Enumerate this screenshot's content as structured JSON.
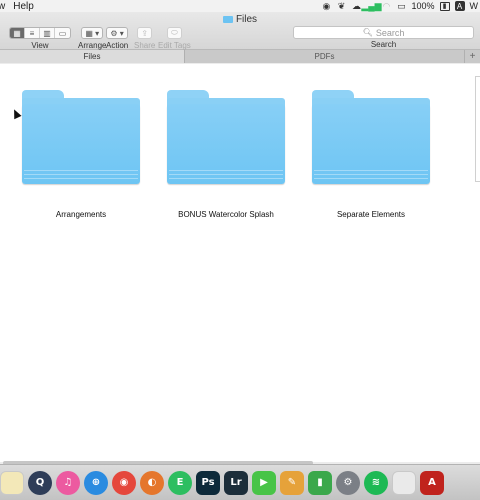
{
  "menubar": {
    "items": [
      "w",
      "Help"
    ],
    "battery": "100%",
    "input_source": "A",
    "clipped_right": "W",
    "status_icons": [
      "record-icon",
      "evernote-icon",
      "creative-cloud-icon",
      "signal-icon",
      "wifi-icon",
      "airplay-icon",
      "battery-icon",
      "input-source-icon"
    ]
  },
  "window": {
    "title": "Files",
    "accent_folder_color": "#6cc3f2"
  },
  "toolbar": {
    "view_label": "View",
    "arrange_label": "Arrange",
    "action_label": "Action",
    "share_label": "Share",
    "edit_tags_label": "Edit Tags",
    "search_label": "Search",
    "search_placeholder": "Search",
    "view_modes": [
      "icon-view-icon",
      "list-view-icon",
      "column-view-icon",
      "cover-flow-icon"
    ],
    "active_view": "icon-view-icon"
  },
  "tabs": [
    {
      "label": "Files",
      "active": true
    },
    {
      "label": "PDFs",
      "active": false
    }
  ],
  "new_tab_label": "+",
  "files": [
    {
      "name": "Arrangements",
      "icon": "folder-icon"
    },
    {
      "name": "BONUS Watercolor Splash",
      "icon": "folder-icon"
    },
    {
      "name": "Separate Elements",
      "icon": "folder-icon"
    }
  ],
  "dock": {
    "apps": [
      {
        "name": "notes-icon",
        "glyph": "",
        "color": "#f3e8b8"
      },
      {
        "name": "quicktime-icon",
        "glyph": "Q",
        "color": "#2e3d58"
      },
      {
        "name": "itunes-icon",
        "glyph": "♫",
        "color": "#ec5aa0"
      },
      {
        "name": "safari-icon",
        "glyph": "⊕",
        "color": "#2a8be0"
      },
      {
        "name": "chrome-icon",
        "glyph": "◉",
        "color": "#e5473c"
      },
      {
        "name": "firefox-icon",
        "glyph": "◐",
        "color": "#e5762c"
      },
      {
        "name": "evernote-icon",
        "glyph": "E",
        "color": "#2dbe60"
      },
      {
        "name": "photoshop-icon",
        "glyph": "Ps",
        "color": "#0d2a3a"
      },
      {
        "name": "lightroom-icon",
        "glyph": "Lr",
        "color": "#1c2e3a"
      },
      {
        "name": "facetime-icon",
        "glyph": "▶",
        "color": "#48c447"
      },
      {
        "name": "photo-editor-icon",
        "glyph": "✎",
        "color": "#e6a23a"
      },
      {
        "name": "numbers-icon",
        "glyph": "▮",
        "color": "#3ba84b"
      },
      {
        "name": "system-preferences-icon",
        "glyph": "⚙",
        "color": "#7b7f86"
      },
      {
        "name": "spotify-icon",
        "glyph": "≋",
        "color": "#1db954"
      },
      {
        "name": "document-icon",
        "glyph": "",
        "color": "#eaeaea"
      },
      {
        "name": "acrobat-icon",
        "glyph": "A",
        "color": "#c0231d"
      }
    ]
  }
}
